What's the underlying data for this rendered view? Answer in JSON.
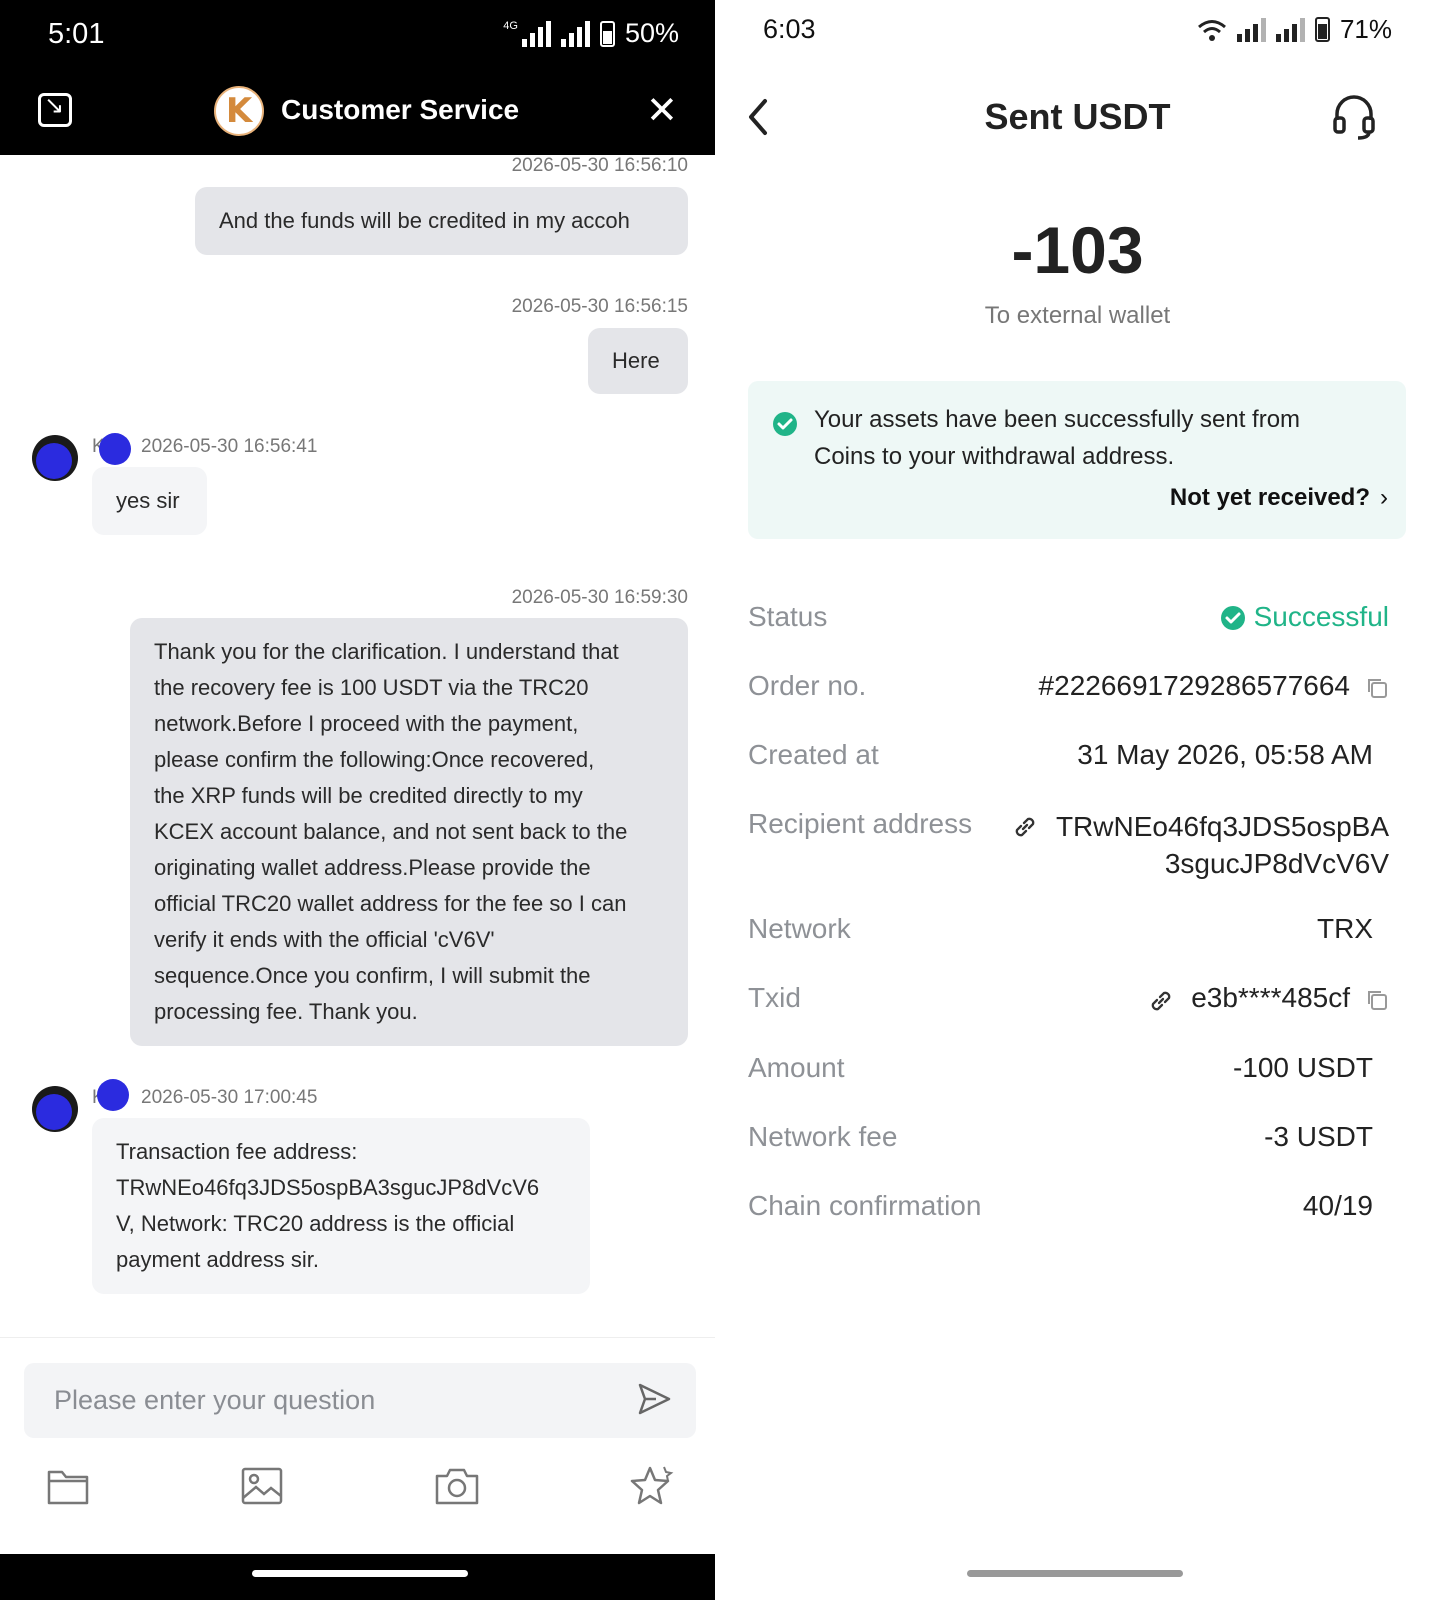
{
  "left": {
    "status_bar": {
      "time": "5:01",
      "network": "4G",
      "battery": "50%"
    },
    "header": {
      "logo_letter": "K",
      "title": "Customer Service"
    },
    "messages": [
      {
        "sender": "me",
        "timestamp": "2026-05-30 16:56:10",
        "text": "And the funds will be credited in my accoh"
      },
      {
        "sender": "me",
        "timestamp": "2026-05-30 16:56:15",
        "text": "Here"
      },
      {
        "sender": "agent",
        "name": "K    n",
        "timestamp": "2026-05-30 16:56:41",
        "text": "yes sir"
      },
      {
        "sender": "me",
        "timestamp": "2026-05-30 16:59:30",
        "lines": [
          "Thank you for the clarification. I understand that",
          "the recovery fee is 100 USDT via the TRC20",
          "network.Before I proceed with the payment,",
          "please confirm the following:Once recovered,",
          "the XRP funds will be credited directly to my",
          "KCEX account balance, and not sent back to the",
          "originating wallet address.Please provide the",
          "official TRC20 wallet address for the fee so I can",
          "verify it ends with the official 'cV6V'",
          "sequence.Once you confirm, I will submit the",
          "processing fee. Thank you."
        ]
      },
      {
        "sender": "agent",
        "name": "K    n",
        "timestamp": "2026-05-30 17:00:45",
        "lines": [
          "Transaction fee address:",
          "TRwNEo46fq3JDS5ospBA3sgucJP8dVcV6",
          "V, Network: TRC20 address is the official",
          "payment address sir."
        ]
      }
    ],
    "composer": {
      "placeholder": "Please enter your question"
    },
    "toolbar": [
      "folder-icon",
      "image-icon",
      "camera-icon",
      "star-icon"
    ]
  },
  "right": {
    "status_bar": {
      "time": "6:03",
      "battery": "71%"
    },
    "header": {
      "title": "Sent USDT"
    },
    "amount": "-103",
    "amount_sub": "To external wallet",
    "notice": {
      "line1": "Your assets have been successfully sent from",
      "line2": "Coins to your withdrawal address.",
      "link": "Not yet received?"
    },
    "details": {
      "status_label": "Status",
      "status_value": "Successful",
      "order_label": "Order no.",
      "order_value": "#2226691729286577664",
      "created_label": "Created at",
      "created_value": "31 May 2026, 05:58 AM",
      "recipient_label": "Recipient address",
      "recipient_line1": "TRwNEo46fq3JDS5ospBA",
      "recipient_line2": "3sgucJP8dVcV6V",
      "network_label": "Network",
      "network_value": "TRX",
      "txid_label": "Txid",
      "txid_value": "e3b****485cf",
      "amount_label": "Amount",
      "amount_value": "-100 USDT",
      "fee_label": "Network fee",
      "fee_value": "-3 USDT",
      "confirm_label": "Chain confirmation",
      "confirm_value": "40/19"
    },
    "colors": {
      "success": "#20b488",
      "notice_bg": "#eef8f6"
    }
  }
}
